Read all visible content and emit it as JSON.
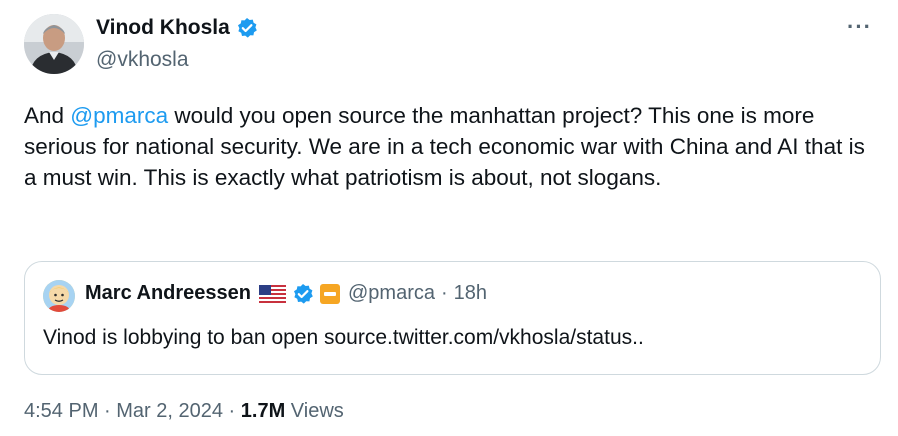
{
  "author": {
    "name": "Vinod Khosla",
    "handle": "@vkhosla"
  },
  "more_label": "···",
  "tweet": {
    "text_before": "And ",
    "mention": "@pmarca",
    "text_after": " would you open source the manhattan project? This one is more serious for national security. We are in a tech economic war with China and AI that is a must win. This is exactly what patriotism is about, not slogans."
  },
  "quote": {
    "name": "Marc Andreessen",
    "handle": "@pmarca",
    "separator": "·",
    "time": "18h",
    "text": "Vinod is lobbying to ban open source.twitter.com/vkhosla/status.."
  },
  "meta": {
    "time": "4:54 PM",
    "separator1": " · ",
    "date": "Mar 2, 2024",
    "separator2": " · ",
    "views_count": "1.7M",
    "views_label": " Views"
  },
  "icons": {
    "verified": "verified-badge-icon",
    "flag": "us-flag-icon",
    "affiliate": "affiliate-badge-icon",
    "more": "more-icon"
  },
  "colors": {
    "accent": "#1d9bf0",
    "text": "#0f1419",
    "secondary": "#536471",
    "border": "#cfd9de"
  }
}
